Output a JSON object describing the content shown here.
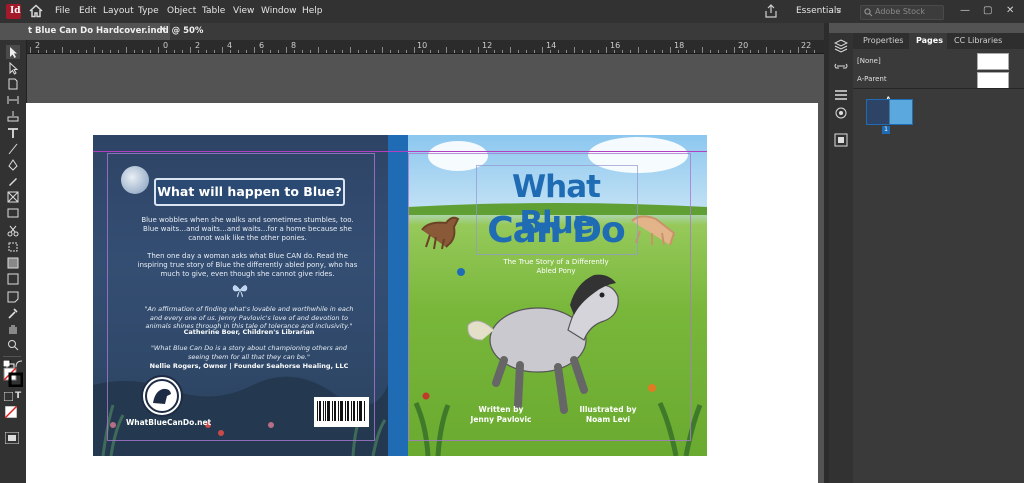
{
  "app": {
    "logo_letter": "Id"
  },
  "menu": [
    "File",
    "Edit",
    "Layout",
    "Type",
    "Object",
    "Table",
    "View",
    "Window",
    "Help"
  ],
  "workspace": {
    "label": "Essentials",
    "chevron": "v"
  },
  "search": {
    "placeholder": "Adobe Stock"
  },
  "window_buttons": [
    "—",
    "▢",
    "✕"
  ],
  "document_tab": {
    "title": "t Blue Can Do Hardcover.indd @ 50%",
    "close": "✕"
  },
  "ruler": {
    "labels": [
      "2",
      "0",
      "2",
      "4",
      "6",
      "8",
      "10",
      "12",
      "14",
      "16",
      "18",
      "20",
      "22"
    ]
  },
  "panel": {
    "tabs": [
      "Properties",
      "Pages",
      "CC Libraries"
    ],
    "masters": [
      "[None]",
      "A-Parent"
    ],
    "spread_master_letter": "A",
    "page_number": "1"
  },
  "back_cover": {
    "title": "What will happen to Blue?",
    "para1": "Blue wobbles when she walks and sometimes stumbles, too. Blue waits…and waits…and waits…for a home because she cannot walk like the other ponies.",
    "para2": "Then one day a woman asks what Blue CAN do. Read the inspiring true story of Blue the differently abled pony, who has much to give, even though she cannot give rides.",
    "quote1": "\"An affirmation of finding what's lovable and worthwhile in each and every one of us. Jenny Pavlovic's love of and devotion to animals shines through in this tale of tolerance and inclusivity.\"",
    "attrib1": "Catherine Boer, Children's Librarian",
    "quote2": "\"What Blue Can Do is a story about championing others and seeing them for all that they can be.\"",
    "attrib2": "Nellie Rogers, Owner | Founder Seahorse Healing, LLC",
    "website": "WhatBlueCanDo.net"
  },
  "front_cover": {
    "title_line1": "What Blue",
    "title_line2": "Can Do",
    "subtitle": "The True Story of a Differently Abled Pony",
    "author_label": "Written by",
    "author": "Jenny Pavlovic",
    "illustrator_label": "Illustrated by",
    "illustrator": "Noam Levi"
  },
  "colors": {
    "spine": "#1f6cb5",
    "title_blue": "#1f6cb5",
    "guide": "#b040c0"
  },
  "icons": {
    "toolbar": [
      "selection-tool-icon",
      "direct-selection-tool-icon",
      "page-tool-icon",
      "gap-tool-icon",
      "content-collector-icon",
      "type-tool-icon",
      "line-tool-icon",
      "pen-tool-icon",
      "pencil-tool-icon",
      "rectangle-frame-tool-icon",
      "rectangle-tool-icon",
      "scissors-tool-icon",
      "free-transform-tool-icon",
      "gradient-swatch-tool-icon",
      "gradient-feather-tool-icon",
      "note-tool-icon",
      "eyedropper-tool-icon",
      "hand-tool-icon",
      "zoom-tool-icon"
    ]
  }
}
